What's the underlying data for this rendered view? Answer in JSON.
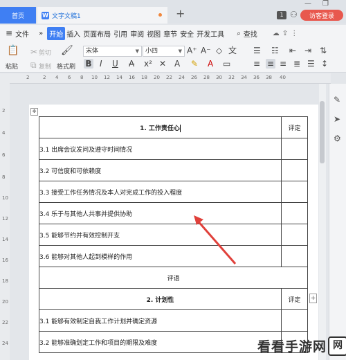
{
  "titlebar": {
    "home_tab": "首页",
    "doc_tab": "文字文稿1",
    "doc_icon": "W",
    "new_tab": "+",
    "badge": "1",
    "visitor_button": "访客登录",
    "window_buttons": [
      "—",
      "❐"
    ]
  },
  "menu": {
    "hamburger": "≡",
    "file": "文件",
    "more": "»",
    "items": [
      "开始",
      "插入",
      "页面布局",
      "引用",
      "审阅",
      "视图",
      "章节",
      "安全",
      "开发工具"
    ],
    "search": "查找"
  },
  "toolbar": {
    "paste": "粘贴",
    "cut": "剪切",
    "copy": "复制",
    "format_painter": "格式刷",
    "font_name": "宋体",
    "font_size": "小四",
    "bold": "B",
    "italic": "I",
    "underline": "U",
    "strike": "A"
  },
  "ruler": {
    "h": [
      "2",
      "2",
      "4",
      "6",
      "8",
      "10",
      "12",
      "14",
      "16",
      "18",
      "20",
      "22",
      "24",
      "26",
      "28",
      "30",
      "32",
      "34",
      "36",
      "38",
      "40"
    ],
    "v": [
      "2",
      "4",
      "6",
      "8",
      "10",
      "12",
      "14",
      "16",
      "18",
      "20",
      "22",
      "24"
    ]
  },
  "table": {
    "section1_title": "1. 工作责任心",
    "rating_label": "评定",
    "section1_items": [
      "3.1 出席会议发问及遵守时间情况",
      "3.2 可信度和可依赖度",
      "3.3 接受工作任务情况及本人对完成工作的投入程度",
      "3.4 乐于与其他人共事并提供协助",
      "3.5 能够节约并有效控制开支",
      "3.6 能够对其他人起到模样的作用"
    ],
    "comment_label": "评语",
    "section2_title": "2. 计划性",
    "section2_items": [
      "3.1 能够有效制定自我工作计划并确定资源",
      "3.2 能够准确划定工作和项目的期限及难度"
    ]
  },
  "watermark": {
    "text": "看看手游网",
    "logo": "网"
  },
  "colors": {
    "accent": "#3f7ff3",
    "visitor": "#e8584e",
    "arrow": "#e0403a"
  }
}
